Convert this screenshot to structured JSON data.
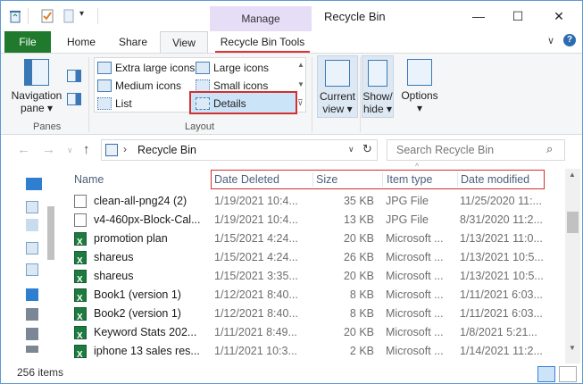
{
  "window": {
    "title": "Recycle Bin",
    "context_tab": "Manage",
    "controls": {
      "minimize": "—",
      "maximize": "☐",
      "close": "✕"
    }
  },
  "ribbon_tabs": [
    {
      "label": "File"
    },
    {
      "label": "Home"
    },
    {
      "label": "Share"
    },
    {
      "label": "View"
    },
    {
      "label": "Recycle Bin Tools"
    }
  ],
  "ribbon": {
    "panes": {
      "nav_label": "Navigation",
      "nav_label2": "pane",
      "group": "Panes"
    },
    "layout": {
      "group": "Layout",
      "options": [
        {
          "label": "Extra large icons"
        },
        {
          "label": "Large icons"
        },
        {
          "label": "Medium icons"
        },
        {
          "label": "Small icons"
        },
        {
          "label": "List"
        },
        {
          "label": "Details"
        }
      ]
    },
    "current_view": {
      "line1": "Current",
      "line2": "view"
    },
    "show_hide": {
      "line1": "Show/",
      "line2": "hide"
    },
    "options": {
      "label": "Options"
    }
  },
  "address": {
    "path": "Recycle Bin",
    "search_placeholder": "Search Recycle Bin"
  },
  "columns": [
    "Name",
    "Date Deleted",
    "Size",
    "Item type",
    "Date modified"
  ],
  "files": [
    {
      "name": "clean-all-png24 (2)",
      "deleted": "1/19/2021 10:4...",
      "size": "35 KB",
      "type": "JPG File",
      "modified": "11/25/2020 11:...",
      "kind": "jpg"
    },
    {
      "name": "v4-460px-Block-Cal...",
      "deleted": "1/19/2021 10:4...",
      "size": "13 KB",
      "type": "JPG File",
      "modified": "8/31/2020 11:2...",
      "kind": "jpg"
    },
    {
      "name": "promotion plan",
      "deleted": "1/15/2021 4:24...",
      "size": "20 KB",
      "type": "Microsoft ...",
      "modified": "1/13/2021 11:0...",
      "kind": "xl"
    },
    {
      "name": "shareus",
      "deleted": "1/15/2021 4:24...",
      "size": "26 KB",
      "type": "Microsoft ...",
      "modified": "1/13/2021 10:5...",
      "kind": "xl"
    },
    {
      "name": "shareus",
      "deleted": "1/15/2021 3:35...",
      "size": "20 KB",
      "type": "Microsoft ...",
      "modified": "1/13/2021 10:5...",
      "kind": "xl"
    },
    {
      "name": "Book1 (version 1)",
      "deleted": "1/12/2021 8:40...",
      "size": "8 KB",
      "type": "Microsoft ...",
      "modified": "1/11/2021 6:03...",
      "kind": "xl"
    },
    {
      "name": "Book2 (version 1)",
      "deleted": "1/12/2021 8:40...",
      "size": "8 KB",
      "type": "Microsoft ...",
      "modified": "1/11/2021 6:03...",
      "kind": "xl"
    },
    {
      "name": "Keyword Stats 202...",
      "deleted": "1/11/2021 8:49...",
      "size": "20 KB",
      "type": "Microsoft ...",
      "modified": "1/8/2021 5:21...",
      "kind": "xl"
    },
    {
      "name": "iphone 13 sales res...",
      "deleted": "1/11/2021 10:3...",
      "size": "2 KB",
      "type": "Microsoft ...",
      "modified": "1/14/2021 11:2...",
      "kind": "xl"
    }
  ],
  "status": {
    "count": "256 items"
  },
  "colors": {
    "file_tab": "#1f7a2e",
    "manage_tab": "#e6ddf7",
    "highlight": "#d32f2f",
    "selection": "#cce4f7"
  }
}
